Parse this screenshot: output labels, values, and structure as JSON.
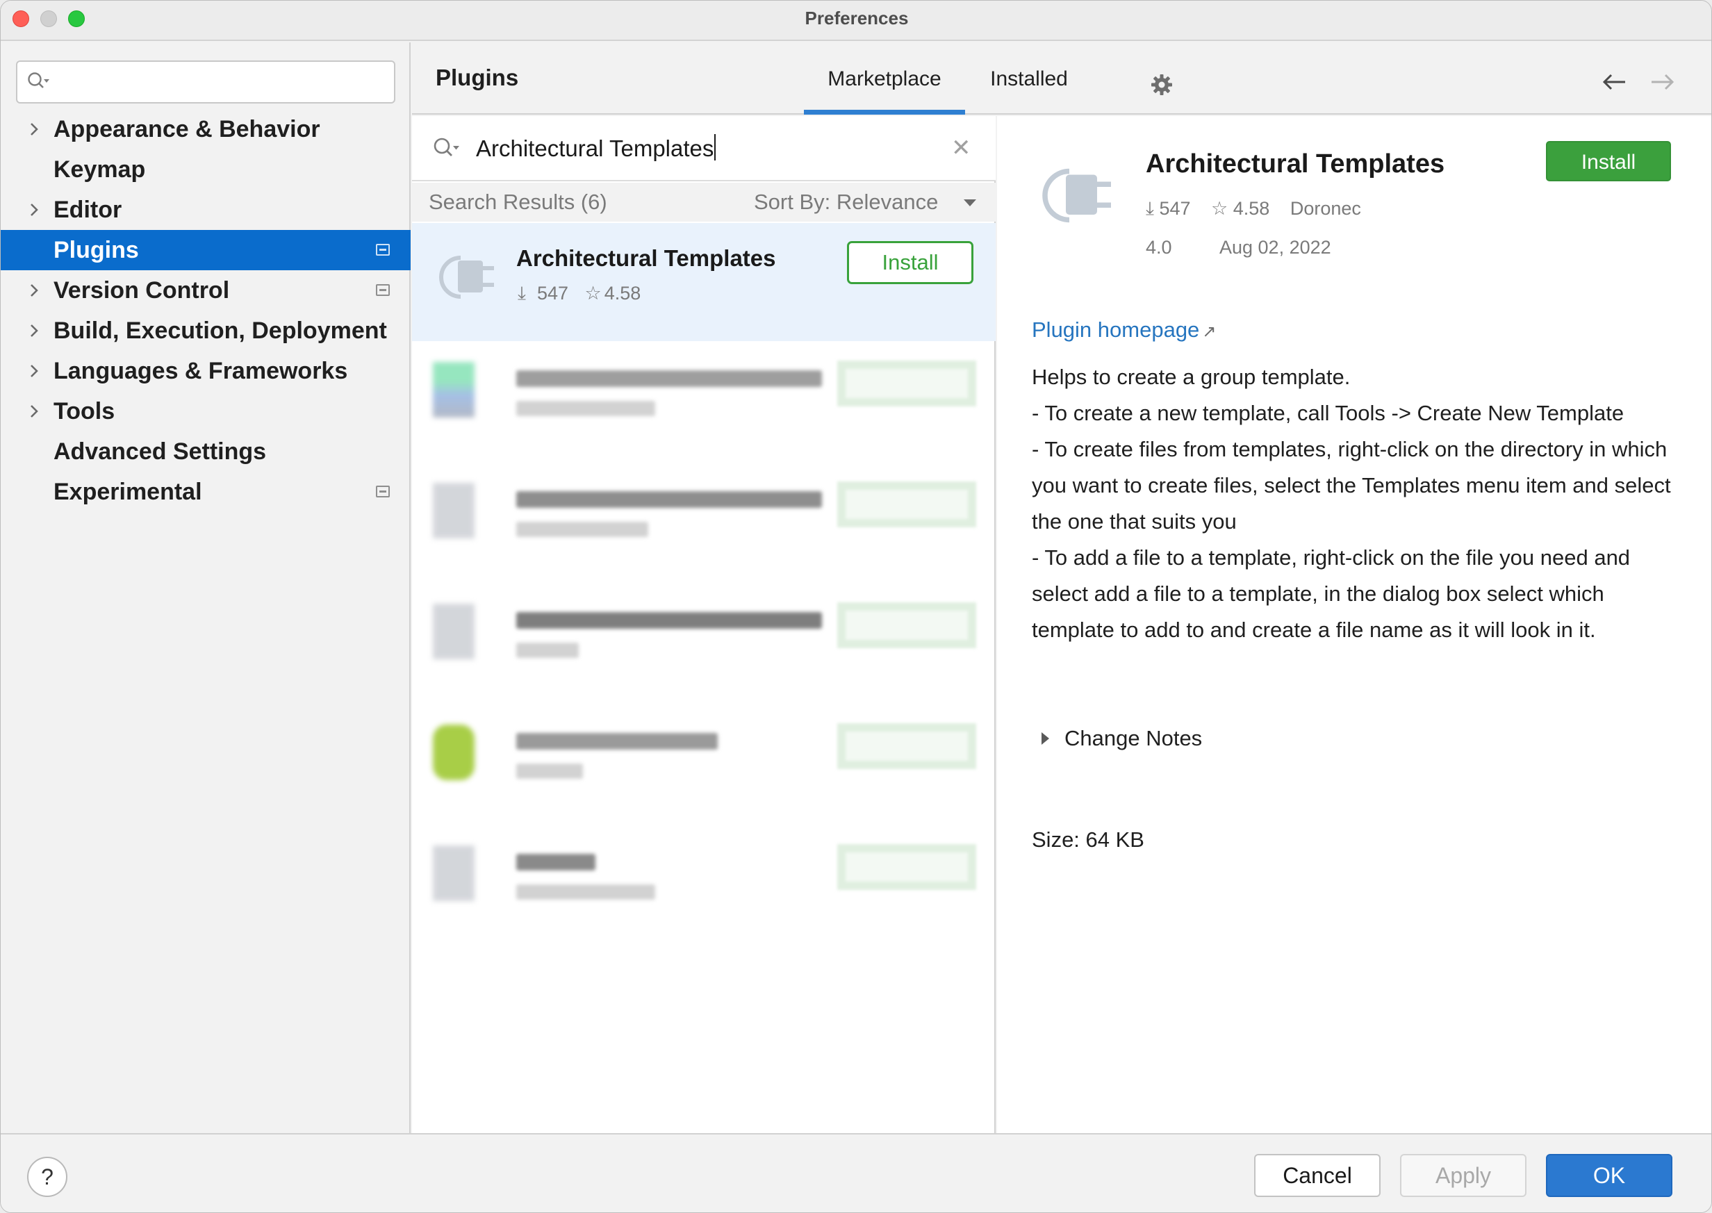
{
  "window": {
    "title": "Preferences"
  },
  "sidebar": {
    "search_placeholder": "",
    "items": [
      {
        "label": "Appearance & Behavior",
        "expandable": true,
        "selected": false,
        "project_icon": false
      },
      {
        "label": "Keymap",
        "expandable": false,
        "selected": false,
        "project_icon": false
      },
      {
        "label": "Editor",
        "expandable": true,
        "selected": false,
        "project_icon": false
      },
      {
        "label": "Plugins",
        "expandable": false,
        "selected": true,
        "project_icon": true
      },
      {
        "label": "Version Control",
        "expandable": true,
        "selected": false,
        "project_icon": true
      },
      {
        "label": "Build, Execution, Deployment",
        "expandable": true,
        "selected": false,
        "project_icon": false
      },
      {
        "label": "Languages & Frameworks",
        "expandable": true,
        "selected": false,
        "project_icon": false
      },
      {
        "label": "Tools",
        "expandable": true,
        "selected": false,
        "project_icon": false
      },
      {
        "label": "Advanced Settings",
        "expandable": false,
        "selected": false,
        "project_icon": false
      },
      {
        "label": "Experimental",
        "expandable": false,
        "selected": false,
        "project_icon": true
      }
    ]
  },
  "header": {
    "title": "Plugins",
    "tabs": [
      {
        "label": "Marketplace",
        "active": true
      },
      {
        "label": "Installed",
        "active": false
      }
    ],
    "icons": [
      "gear-icon",
      "arrow-left-icon",
      "arrow-right-icon"
    ]
  },
  "results": {
    "search_value": "Architectural Templates",
    "count_label": "Search Results (6)",
    "sort_label": "Sort By: Relevance",
    "first": {
      "name": "Architectural Templates",
      "downloads": "547",
      "rating": "4.58",
      "install_label": "Install"
    }
  },
  "detail": {
    "name": "Architectural Templates",
    "install_label": "Install",
    "downloads": "547",
    "rating": "4.58",
    "vendor": "Doronec",
    "version": "4.0",
    "date": "Aug 02, 2022",
    "homepage_label": "Plugin homepage",
    "description": [
      "Helps to create a group template.",
      "- To create a new template, call Tools -> Create New Template",
      "- To create files from templates, right-click on the directory in which you want to create files, select the Templates menu item and select the one that suits you",
      "- To add a file to a template, right-click on the file you need and select add a file to a template, in the dialog box select which template to add to and create a file name as it will look in it."
    ],
    "change_notes_label": "Change Notes",
    "size_label": "Size: 64 KB"
  },
  "footer": {
    "help_label": "?",
    "cancel_label": "Cancel",
    "apply_label": "Apply",
    "ok_label": "OK"
  },
  "colors": {
    "selection": "#0a6ccc",
    "install_green": "#3ba03d",
    "link_blue": "#2675bf",
    "ok_blue": "#2b79d0"
  }
}
